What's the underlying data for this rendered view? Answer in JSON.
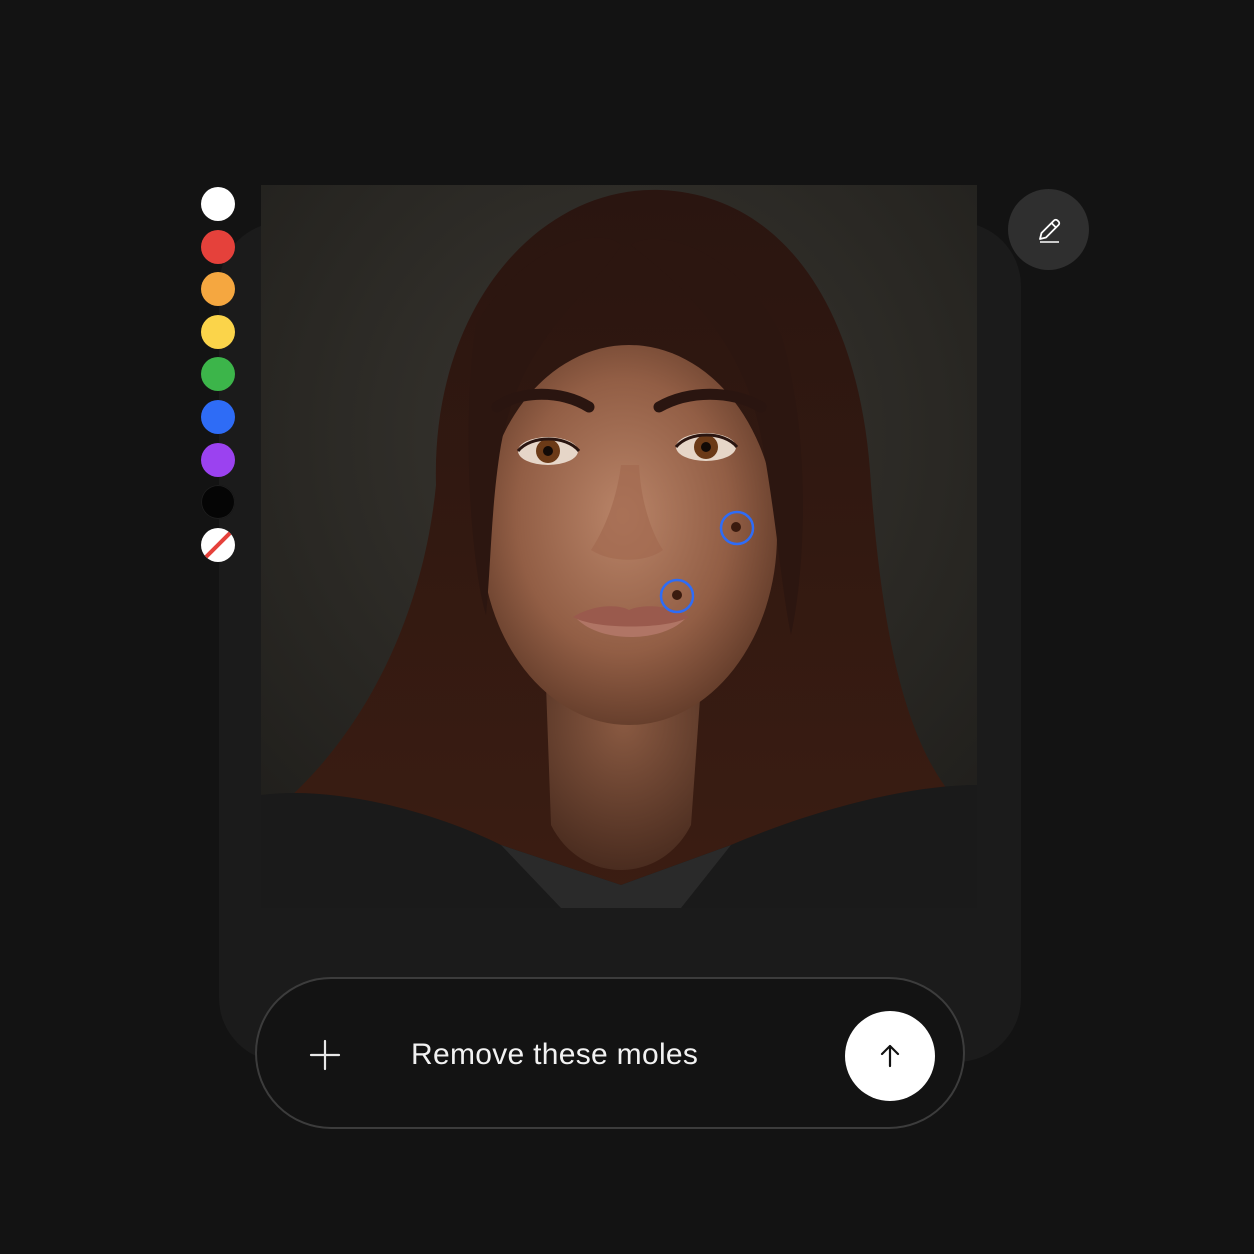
{
  "palette": {
    "colors": [
      {
        "name": "white",
        "hex": "#ffffff"
      },
      {
        "name": "red",
        "hex": "#e5413b"
      },
      {
        "name": "orange",
        "hex": "#f5a740"
      },
      {
        "name": "yellow",
        "hex": "#fbd44a"
      },
      {
        "name": "green",
        "hex": "#3cb54a"
      },
      {
        "name": "blue",
        "hex": "#2e6cf6"
      },
      {
        "name": "purple",
        "hex": "#9b42f0"
      },
      {
        "name": "black",
        "hex": "#050505"
      }
    ],
    "clear_icon": "no-color-icon"
  },
  "edit": {
    "icon": "pencil-icon"
  },
  "canvas": {
    "image_subject": "portrait photo of a woman with dark shoulder-length hair",
    "annotation_color": "#2e6cf6",
    "markers": 2
  },
  "prompt": {
    "add_icon": "plus-icon",
    "text": "Remove these moles",
    "send_icon": "arrow-up-icon"
  }
}
